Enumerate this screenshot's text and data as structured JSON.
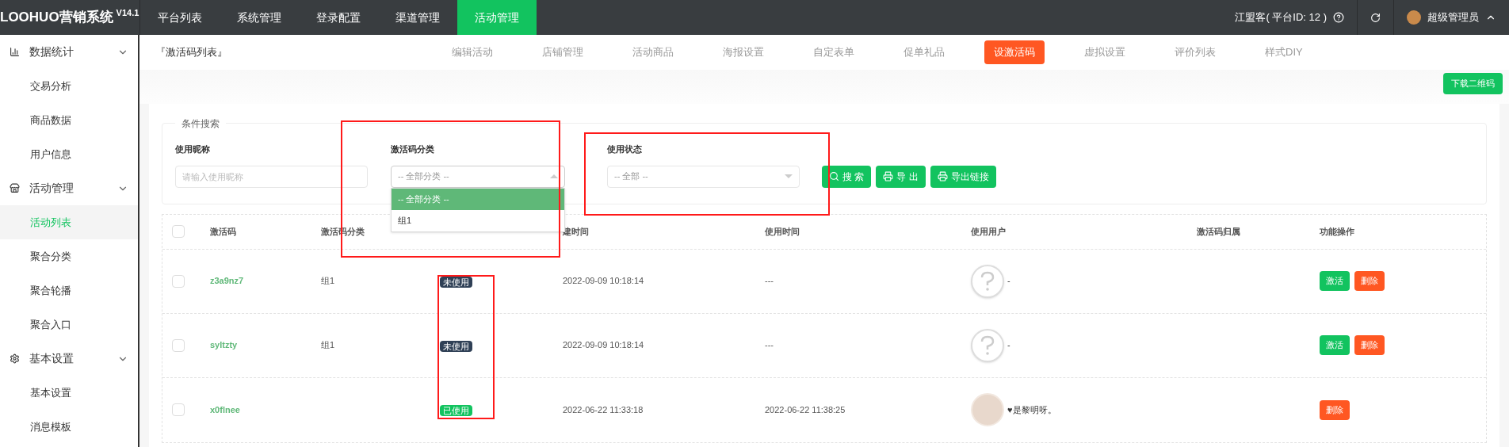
{
  "header": {
    "logo": "LOOHUO营销系统",
    "version": "V14.1",
    "nav": [
      {
        "label": "平台列表",
        "selected": false
      },
      {
        "label": "系统管理",
        "selected": false
      },
      {
        "label": "登录配置",
        "selected": false
      },
      {
        "label": "渠道管理",
        "selected": false
      },
      {
        "label": "活动管理",
        "selected": true
      }
    ],
    "platform": "江盟客( 平台ID: 12 )",
    "user": "超级管理员"
  },
  "sidebar": {
    "groups": [
      {
        "label": "数据统计",
        "kind": "chart",
        "expanded": true,
        "children": [
          {
            "label": "交易分析",
            "selected": false
          },
          {
            "label": "商品数据",
            "selected": false
          },
          {
            "label": "用户信息",
            "selected": false
          }
        ]
      },
      {
        "label": "活动管理",
        "kind": "shop",
        "expanded": true,
        "children": [
          {
            "label": "活动列表",
            "selected": true
          },
          {
            "label": "聚合分类",
            "selected": false
          },
          {
            "label": "聚合轮播",
            "selected": false
          },
          {
            "label": "聚合入口",
            "selected": false
          }
        ]
      },
      {
        "label": "基本设置",
        "kind": "settings",
        "expanded": true,
        "children": [
          {
            "label": "基本设置",
            "selected": false
          },
          {
            "label": "消息模板",
            "selected": false
          }
        ]
      }
    ]
  },
  "subnav": {
    "title": "『激活码列表』",
    "tabs": [
      {
        "label": "编辑活动",
        "selected": false
      },
      {
        "label": "店铺管理",
        "selected": false
      },
      {
        "label": "活动商品",
        "selected": false
      },
      {
        "label": "海报设置",
        "selected": false
      },
      {
        "label": "自定表单",
        "selected": false
      },
      {
        "label": "促单礼品",
        "selected": false
      },
      {
        "label": "设激活码",
        "selected": true
      },
      {
        "label": "虚拟设置",
        "selected": false
      },
      {
        "label": "评价列表",
        "selected": false
      },
      {
        "label": "样式DIY",
        "selected": false
      }
    ],
    "download_button": "下载二维码"
  },
  "search": {
    "legend": "条件搜索",
    "nickname": {
      "label": "使用昵称",
      "placeholder": "请输入使用昵称"
    },
    "category": {
      "label": "激活码分类",
      "placeholder": "-- 全部分类 --",
      "expanded": true,
      "options": [
        {
          "label": "-- 全部分类 --",
          "selected": true
        },
        {
          "label": "组1",
          "selected": false
        }
      ]
    },
    "status": {
      "label": "使用状态",
      "placeholder": "-- 全部 --"
    },
    "buttons": [
      {
        "label": "搜 索",
        "kind": "search"
      },
      {
        "label": "导 出",
        "kind": "export"
      },
      {
        "label": "导出链接",
        "kind": "export"
      }
    ]
  },
  "table": {
    "all_checked": false,
    "columns": [
      "激活码",
      "激活码分类",
      "建时间",
      "使用时间",
      "使用用户",
      "激活码归属",
      "功能操作"
    ],
    "rows": [
      {
        "checked": false,
        "code": "z3a9nz7",
        "category": "组1",
        "status": {
          "label": "未使用",
          "kind": "unused"
        },
        "created": "2022-09-09 10:18:14",
        "used_time": "---",
        "user": {
          "name": "-",
          "avatar": {
            "kind": "unknown"
          }
        },
        "actions": [
          {
            "label": "激活",
            "kind": "activate"
          },
          {
            "label": "删除",
            "kind": "delete"
          }
        ]
      },
      {
        "checked": false,
        "code": "syltzty",
        "category": "组1",
        "status": {
          "label": "未使用",
          "kind": "unused"
        },
        "created": "2022-09-09 10:18:14",
        "used_time": "---",
        "user": {
          "name": "-",
          "avatar": {
            "kind": "unknown"
          }
        },
        "actions": [
          {
            "label": "激活",
            "kind": "activate"
          },
          {
            "label": "删除",
            "kind": "delete"
          }
        ]
      },
      {
        "checked": false,
        "code": "x0flnee",
        "status": {
          "label": "已使用",
          "kind": "used"
        },
        "created": "2022-06-22 11:33:18",
        "used_time": "2022-06-22 11:38:25",
        "user": {
          "name": "♥是黎明呀。",
          "avatar": {
            "kind": "photo"
          }
        },
        "actions": [
          {
            "label": "删除",
            "kind": "delete"
          }
        ]
      }
    ]
  }
}
